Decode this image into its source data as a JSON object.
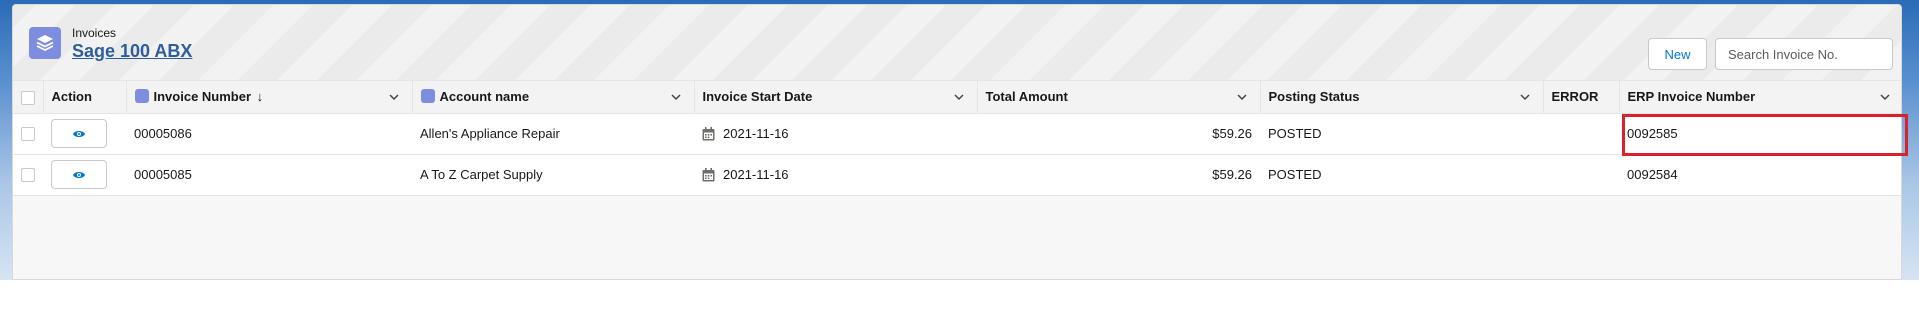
{
  "header": {
    "object_label": "Invoices",
    "list_title": "Sage 100 ABX",
    "new_button": "New",
    "search_placeholder": "Search Invoice No."
  },
  "columns": {
    "action": "Action",
    "invoice_number": "Invoice Number",
    "sort_indicator": "↓",
    "account_name": "Account name",
    "invoice_start_date": "Invoice Start Date",
    "total_amount": "Total Amount",
    "posting_status": "Posting Status",
    "error": "ERROR",
    "erp_invoice_number": "ERP Invoice Number"
  },
  "rows": [
    {
      "invoice_number": "00005086",
      "account_name": "Allen's Appliance Repair",
      "invoice_start_date": "2021-11-16",
      "total_amount": "$59.26",
      "posting_status": "POSTED",
      "error": "",
      "erp_invoice_number": "0092585"
    },
    {
      "invoice_number": "00005085",
      "account_name": "A To Z Carpet Supply",
      "invoice_start_date": "2021-11-16",
      "total_amount": "$59.26",
      "posting_status": "POSTED",
      "error": "",
      "erp_invoice_number": "0092584"
    }
  ],
  "icons": {
    "object": "stack-layers-icon",
    "row_action": "eye-icon",
    "date": "calendar-icon",
    "column_menu": "chevron-down-icon"
  },
  "colors": {
    "brand_blue": "#0176d3",
    "object_icon": "#7f8de1",
    "highlight_red": "#d8222e",
    "title_link": "#2e5d9f"
  }
}
